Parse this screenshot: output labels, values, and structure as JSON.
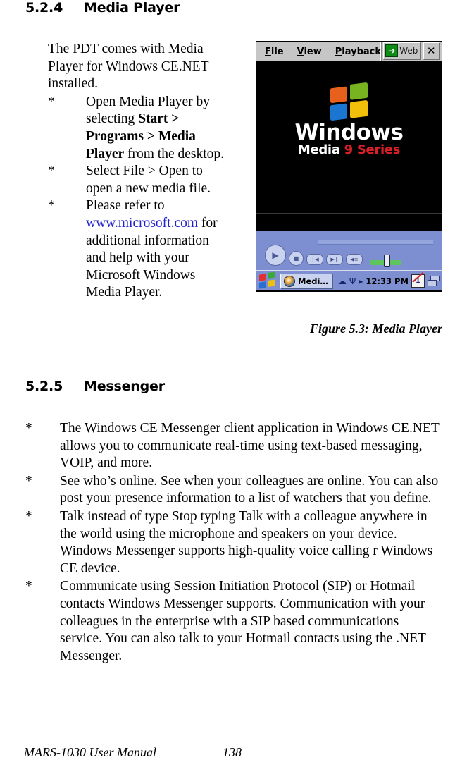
{
  "sections": {
    "media_player": {
      "number": "5.2.4",
      "title": "Media Player",
      "intro": "The PDT comes with Media Player for Windows CE.NET installed.",
      "bullets": [
        {
          "marker": "*",
          "pre": "Open Media Player by selecting ",
          "bold": "Start > Programs > Media Player",
          "post": " from the desktop."
        },
        {
          "marker": "*",
          "text": "Select File > Open to open a new media file."
        },
        {
          "marker": "*",
          "pre": "Please refer to ",
          "link": "www.microsoft.com",
          "post": " for additional information and help with your Microsoft Windows Media Player."
        }
      ],
      "figure_caption": "Figure 5.3: Media Player"
    },
    "messenger": {
      "number": "5.2.5",
      "title": "Messenger",
      "bullets": [
        {
          "marker": "*",
          "text": "The Windows CE Messenger client application in Windows CE.NET allows you to communicate real-time using text-based messaging, VOIP, and more."
        },
        {
          "marker": "*",
          "text": "See who’s online. See when your colleagues are online. You can also post your presence information to a list of watchers that you define."
        },
        {
          "marker": "*",
          "text": "Talk instead of type Stop typing Talk with a colleague anywhere in the world using the microphone and speakers on your device. Windows Messenger supports high-quality voice calling r Windows CE device."
        },
        {
          "marker": "*",
          "text": "Communicate using Session Initiation Protocol (SIP) or Hotmail contacts Windows Messenger supports. Communication with your colleagues in the enterprise with a SIP based communications service. You can also talk to your Hotmail contacts using the .NET Messenger."
        }
      ]
    }
  },
  "device_screenshot": {
    "menus": [
      {
        "label": "File",
        "accel": "F"
      },
      {
        "label": "View",
        "accel": "V"
      },
      {
        "label": "Playback",
        "accel": "P"
      }
    ],
    "web_button": {
      "label": "Web",
      "icon": "arrow-right-icon",
      "icon_glyph": "➔",
      "color": "#0f8b18"
    },
    "close_button": {
      "label": "✕",
      "icon": "close-icon"
    },
    "splash": {
      "logo_icon": "windows-flag-icon",
      "line1": "Windows",
      "line2_white": "Media",
      "line2_red": "9 Series",
      "background": "#000000",
      "red": "#d92027"
    },
    "transport": {
      "play": {
        "name": "play-button",
        "glyph": "▶"
      },
      "stop": {
        "name": "stop-button",
        "glyph": "■"
      },
      "prev": {
        "name": "previous-track-button",
        "glyph": "❘◀"
      },
      "next": {
        "name": "next-track-button",
        "glyph": "▶❘"
      },
      "mute": {
        "name": "mute-button",
        "glyph": "◀≡"
      },
      "volume_label": "volume-slider",
      "volume_color": "#5ec45e",
      "bar_color": "#7d8fd0"
    },
    "taskbar": {
      "start_button": "start-button",
      "task": {
        "icon": "windows-media-player-icon",
        "label": "Medi…"
      },
      "tray": [
        {
          "name": "network-connection-icon",
          "glyph": "☁"
        },
        {
          "name": "antenna-icon",
          "glyph": "Ψ"
        },
        {
          "name": "play-indicator-icon",
          "glyph": "▸"
        }
      ],
      "time": "12:33 PM",
      "tray_right": [
        {
          "name": "input-panel-icon",
          "label": "1"
        },
        {
          "name": "desktop-switch-icon"
        }
      ]
    }
  },
  "footer": {
    "title": "MARS-1030 User Manual",
    "page": "138"
  }
}
